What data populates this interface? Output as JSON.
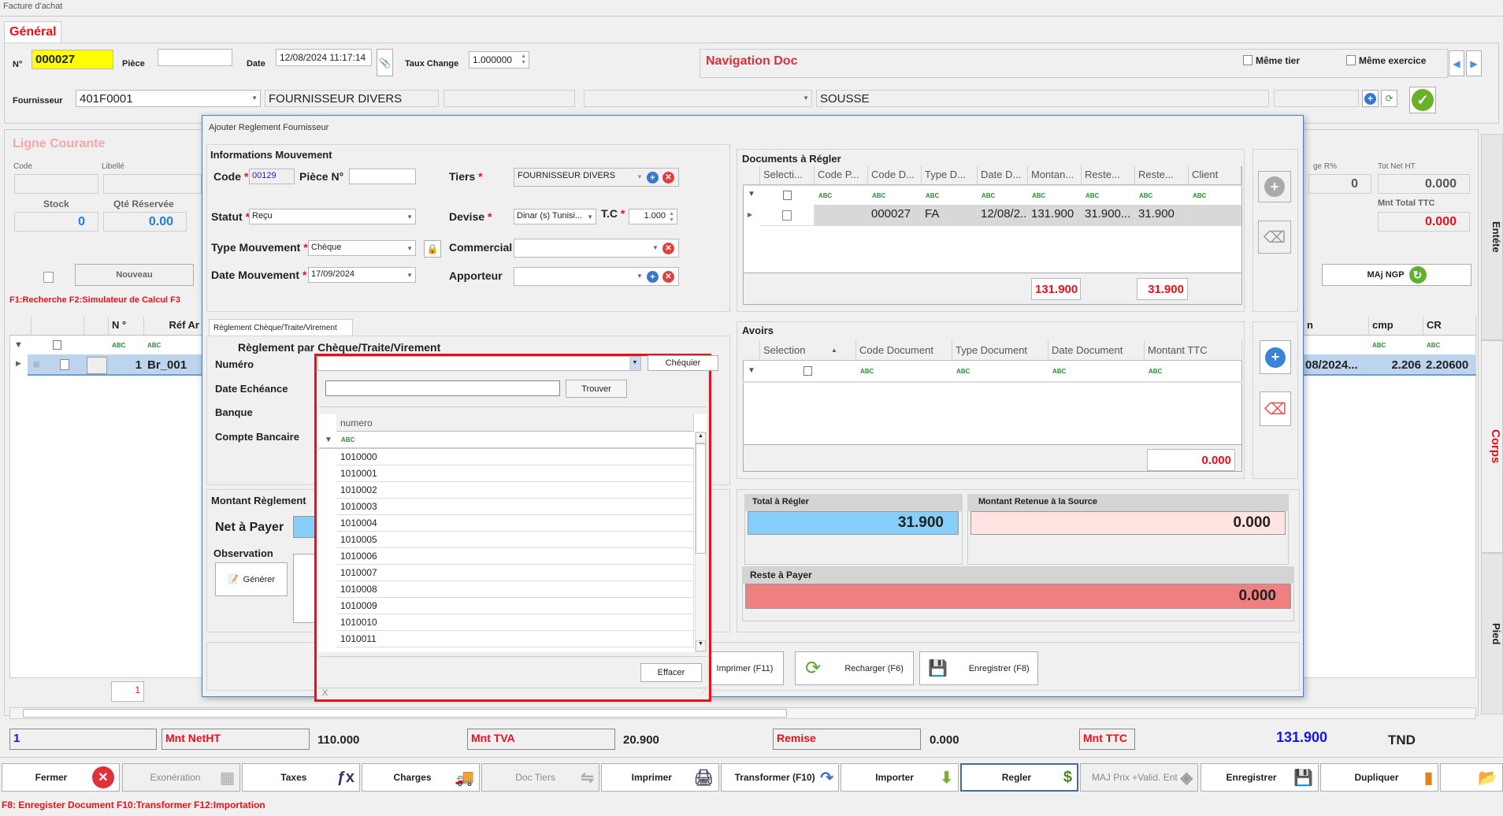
{
  "window_title": "Facture d'achat",
  "tab_general": "Général",
  "header": {
    "num_label": "N°",
    "num_value": "000027",
    "piece_label": "Pièce",
    "piece_value": "",
    "date_label": "Date",
    "date_value": "12/08/2024 11:17:14",
    "taux_label": "Taux Change",
    "taux_value": "1.000000",
    "fournisseur_label": "Fournisseur",
    "fournisseur_code": "401F0001",
    "fournisseur_name": "FOURNISSEUR DIVERS",
    "ville": "SOUSSE",
    "nav_title": "Navigation Doc",
    "meme_tier": "Même tier",
    "meme_exercice": "Même exercice"
  },
  "ligne": {
    "title": "Ligne Courante",
    "code_label": "Code",
    "libelle_label": "Libellé",
    "stock_label": "Stock",
    "stock_value": "0",
    "qte_label": "Qté Réservée",
    "qte_value": "0.00",
    "nouveau": "Nouveau",
    "shortcuts": "F1:Recherche   F2:Simulateur de Calcul   F3",
    "remise_label": "ge R%",
    "remise_value": "0",
    "totnet_label": "Tot Net HT",
    "totnet_value": "0.000",
    "mnt_ttc_label": "Mnt Total  TTC",
    "mnt_ttc_value": "0.000",
    "majngp": "MAj NGP"
  },
  "main_grid": {
    "headers": [
      "N °",
      "Réf Ar",
      "n",
      "cmp",
      "CR"
    ],
    "row": {
      "n": "1",
      "ref": "Br_001",
      "date": "08/2024...",
      "cmp": "2.206",
      "cr": "2.20600"
    },
    "page": "1"
  },
  "side_tabs": [
    "Entéte",
    "Corps",
    "Pied"
  ],
  "totals": {
    "count": "1",
    "netht_label": "Mnt NetHT",
    "netht": "110.000",
    "tva_label": "Mnt TVA",
    "tva": "20.900",
    "remise_label": "Remise",
    "remise": "0.000",
    "ttc_label": "Mnt TTC",
    "ttc": "131.900",
    "currency": "TND"
  },
  "bottom_buttons": [
    {
      "label": "Fermer",
      "icon": "close-icon"
    },
    {
      "label": "Exonération",
      "icon": "grid-icon"
    },
    {
      "label": "Taxes",
      "icon": "function-icon"
    },
    {
      "label": "Charges",
      "icon": "truck-icon"
    },
    {
      "label": "Doc Tiers",
      "icon": "handshake-icon"
    },
    {
      "label": "Imprimer",
      "icon": "printer-icon"
    },
    {
      "label": "Transformer (F10)",
      "icon": "arrow-redo-icon"
    },
    {
      "label": "Importer",
      "icon": "download-icon"
    },
    {
      "label": "Regler",
      "icon": "money-icon"
    },
    {
      "label": "MAJ Prix +Valid. Ent",
      "icon": "tag-icon"
    },
    {
      "label": "Enregistrer",
      "icon": "save-icon"
    },
    {
      "label": "Dupliquer",
      "icon": "copy-icon"
    },
    {
      "label": "",
      "icon": "folder-icon"
    }
  ],
  "footer_shortcuts": "F8: Enregister Document   F10:Transformer   F12:Importation",
  "dialog": {
    "title": "Ajouter Reglement Fournisseur",
    "info": {
      "title": "Informations Mouvement",
      "code_label": "Code",
      "code_value": "00129",
      "piece_label": "Pièce N°",
      "piece_value": "",
      "tiers_label": "Tiers",
      "tiers_value": "FOURNISSEUR DIVERS",
      "statut_label": "Statut",
      "statut_value": "Reçu",
      "devise_label": "Devise",
      "devise_value": "Dinar (s) Tunisi...",
      "tc_label": "T.C",
      "tc_value": "1.000",
      "type_label": "Type Mouvement",
      "type_value": "Chèque",
      "commercial_label": "Commercial",
      "commercial_value": "",
      "date_label": "Date Mouvement",
      "date_value": "17/09/2024",
      "apporteur_label": "Apporteur",
      "apporteur_value": ""
    },
    "tab": "Règlement Chèque/Traite/Virement",
    "reglement": {
      "title": "Règlement par Chèque/Traite/Virement",
      "numero_label": "Numéro",
      "echeance_label": "Date Echéance",
      "banque_label": "Banque",
      "compte_label": "Compte Bancaire"
    },
    "montant": {
      "title": "Montant Règlement",
      "net_label": "Net à Payer",
      "obs_label": "Observation",
      "generer": "Générer"
    },
    "docs": {
      "title": "Documents à Régler",
      "headers": [
        "Selecti...",
        "Code P...",
        "Code D...",
        "Type D...",
        "Date D...",
        "Montan...",
        "Reste...",
        "Reste...",
        "Client"
      ],
      "row": [
        "",
        "",
        "000027",
        "FA",
        "12/08/2...",
        "131.900",
        "31.900...",
        "31.900",
        ""
      ],
      "total_montant": "131.900",
      "total_reste": "31.900"
    },
    "avoirs": {
      "title": "Avoirs",
      "headers": [
        "Selection",
        "Code Document",
        "Type Document",
        "Date Document",
        "Montant TTC"
      ],
      "total": "0.000"
    },
    "total_regler_label": "Total à Régler",
    "total_regler": "31.900",
    "retenue_label": "Montant Retenue à la Source",
    "retenue": "0.000",
    "reste_label": "Reste à Payer",
    "reste": "0.000",
    "buttons": {
      "imprimer": "Imprimer (F11)",
      "recharger": "Recharger (F6)",
      "enregistrer": "Enregistrer (F8)"
    },
    "colors": {
      "total_bg": "#87cefa",
      "retenue_bg": "#ffe4e1",
      "reste_bg": "#f08080"
    }
  },
  "popup": {
    "numero_value": "",
    "chequier": "Chéquier",
    "search_value": "",
    "trouver": "Trouver",
    "column": "numero",
    "rows": [
      "1010000",
      "1010001",
      "1010002",
      "1010003",
      "1010004",
      "1010005",
      "1010006",
      "1010007",
      "1010008",
      "1010009",
      "1010010",
      "1010011"
    ],
    "effacer": "Effacer",
    "close": "X",
    "border_color": "#e8101a"
  }
}
